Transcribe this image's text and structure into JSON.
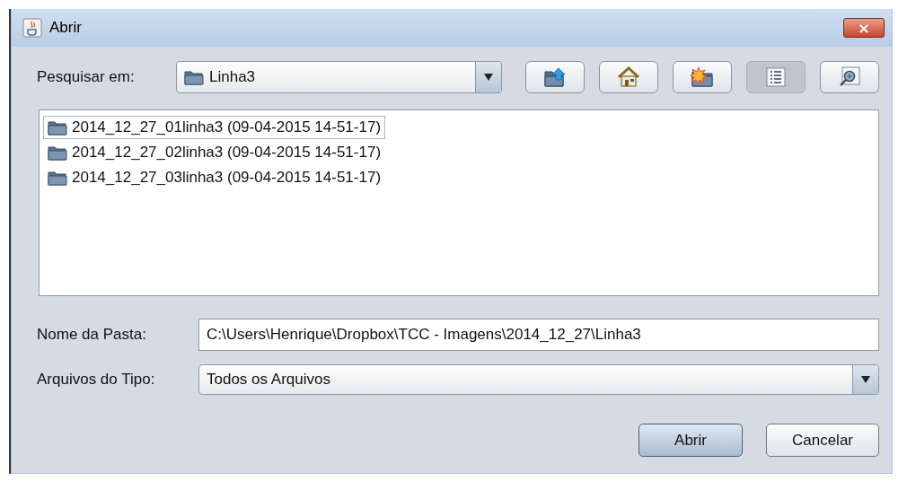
{
  "window": {
    "title": "Abrir",
    "close_label": "×"
  },
  "look_in": {
    "label": "Pesquisar em:",
    "value": "Linha3"
  },
  "toolbar": [
    {
      "kind": "up",
      "selected": false
    },
    {
      "kind": "home",
      "selected": false
    },
    {
      "kind": "new-folder",
      "selected": false
    },
    {
      "kind": "list",
      "selected": true
    },
    {
      "kind": "details",
      "selected": false
    }
  ],
  "files": [
    {
      "name": "2014_12_27_01linha3 (09-04-2015 14-51-17)",
      "selected": true
    },
    {
      "name": "2014_12_27_02linha3 (09-04-2015 14-51-17)",
      "selected": false
    },
    {
      "name": "2014_12_27_03linha3 (09-04-2015 14-51-17)",
      "selected": false
    }
  ],
  "folder_name": {
    "label": "Nome da Pasta:",
    "value": "C:\\Users\\Henrique\\Dropbox\\TCC - Imagens\\2014_12_27\\Linha3"
  },
  "file_type": {
    "label": "Arquivos do Tipo:",
    "value": "Todos os Arquivos"
  },
  "buttons": [
    {
      "label": "Abrir",
      "kind": "default"
    },
    {
      "label": "Cancelar",
      "kind": "normal"
    }
  ]
}
